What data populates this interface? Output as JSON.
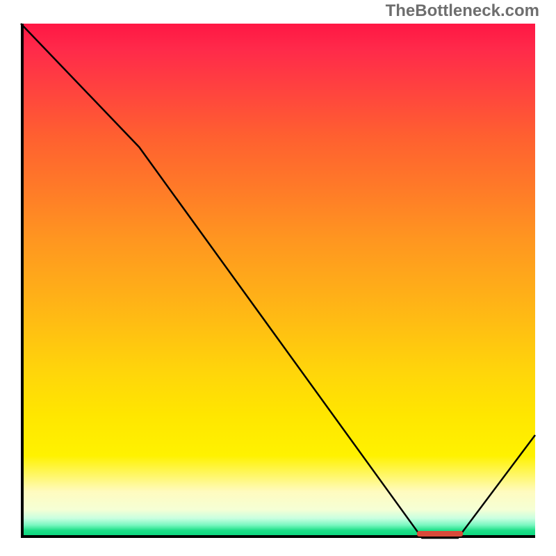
{
  "attribution": "TheBottleneck.com",
  "colors": {
    "axis": "#000000",
    "curve": "#000000",
    "attribution_text": "#6e6e6e",
    "marker": "#d94a3a"
  },
  "chart_data": {
    "type": "line",
    "title": "",
    "xlabel": "",
    "ylabel": "",
    "xlim": [
      0,
      100
    ],
    "ylim": [
      0,
      100
    ],
    "series": [
      {
        "name": "curve",
        "x": [
          0,
          23,
          78,
          85,
          100
        ],
        "y": [
          100,
          76,
          0,
          0,
          20
        ]
      }
    ],
    "marker": {
      "x_start": 77,
      "x_end": 86,
      "y": 0,
      "label": ""
    }
  }
}
